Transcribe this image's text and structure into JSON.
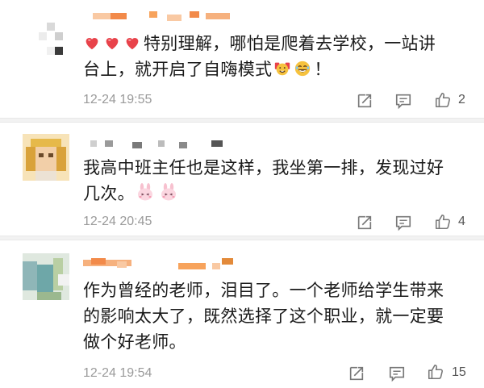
{
  "comments": [
    {
      "username": "",
      "text_lines": [
        "特别理解，哪怕是爬着去学校，一站讲",
        "台上，就开启了自嗨模式",
        "！"
      ],
      "time": "12-24 19:55",
      "likes": "2",
      "avatar_icon": "pixelated-avatar-icon",
      "emojis_before": [
        "heart-emoji",
        "heart-emoji",
        "heart-emoji"
      ],
      "emojis_inline": [
        "cheering-emoji",
        "laughing-emoji"
      ]
    },
    {
      "username": "",
      "text_lines": [
        "我高中班主任也是这样，我坐第一排，发现过好",
        "几次。"
      ],
      "time": "12-24 20:45",
      "likes": "4",
      "avatar_icon": "pixelated-avatar-icon",
      "emojis_inline": [
        "bunny-emoji",
        "bunny-emoji"
      ]
    },
    {
      "username": "",
      "text_lines": [
        "作为曾经的老师，泪目了。一个老师给学生带来",
        "的影响太大了，既然选择了这个职业，就一定要",
        "做个好老师。"
      ],
      "time": "12-24 19:54",
      "likes": "15",
      "avatar_icon": "pixelated-avatar-icon"
    }
  ],
  "actions": {
    "share_icon": "share-icon",
    "reply_icon": "reply-icon",
    "like_icon": "thumbs-up-icon"
  },
  "colors": {
    "text": "#1a1a1a",
    "meta": "#9a9a9a",
    "heart": "#e8424a",
    "divider": "#f2f2f2",
    "name_mosaic": "#f7a35c"
  }
}
